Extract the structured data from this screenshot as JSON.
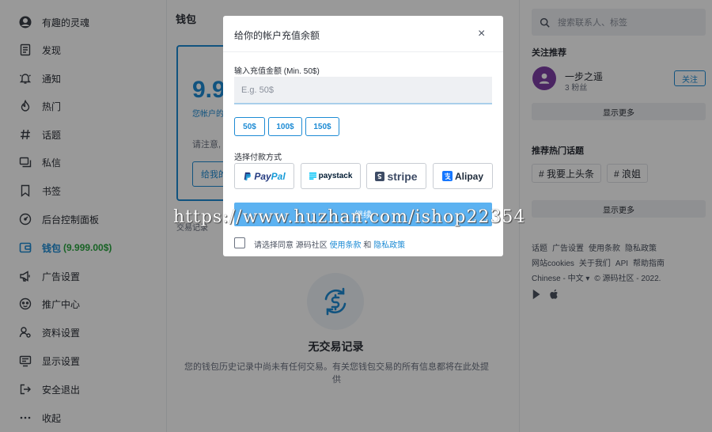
{
  "sidebar": {
    "items": [
      {
        "label": "有趣的灵魂",
        "icon": "avatar-icon"
      },
      {
        "label": "发现",
        "icon": "document-icon"
      },
      {
        "label": "通知",
        "icon": "bell-icon"
      },
      {
        "label": "热门",
        "icon": "fire-icon"
      },
      {
        "label": "话题",
        "icon": "hashtag-icon"
      },
      {
        "label": "私信",
        "icon": "message-icon"
      },
      {
        "label": "书签",
        "icon": "bookmark-icon"
      },
      {
        "label": "后台控制面板",
        "icon": "dashboard-icon"
      },
      {
        "label": "钱包",
        "amount": "(9.999.00$)",
        "icon": "wallet-icon"
      },
      {
        "label": "广告设置",
        "icon": "megaphone-icon"
      },
      {
        "label": "推广中心",
        "icon": "referral-icon"
      },
      {
        "label": "资料设置",
        "icon": "user-settings-icon"
      },
      {
        "label": "显示设置",
        "icon": "display-icon"
      },
      {
        "label": "安全退出",
        "icon": "logout-icon"
      },
      {
        "label": "收起",
        "icon": "more-icon"
      }
    ]
  },
  "main": {
    "title": "钱包",
    "wallet": {
      "balance": "9.9",
      "subtitle": "您帐户的",
      "note": "请注意,",
      "button": "给我的"
    },
    "transactions_label": "交易记录",
    "empty": {
      "title": "无交易记录",
      "description": "您的钱包历史记录中尚未有任何交易。有关您钱包交易的所有信息都将在此处提供"
    }
  },
  "right": {
    "search_placeholder": "搜索联系人、标签",
    "follow_title": "关注推荐",
    "follow_user": {
      "name": "一步之遥",
      "followers": "3 粉丝",
      "button": "关注"
    },
    "show_more": "显示更多",
    "topics_title": "推荐热门话题",
    "topics": [
      "# 我要上头条",
      "# 浪姐"
    ],
    "footer_line1": [
      "话题",
      "广告设置",
      "使用条款",
      "隐私政策"
    ],
    "footer_line2": [
      "网站cookies",
      "关于我们",
      "API",
      "帮助指南"
    ],
    "footer_line3": [
      "Chinese - 中文 ▾",
      "© 源码社区 - 2022."
    ]
  },
  "modal": {
    "title": "给你的帐户充值余额",
    "close": "×",
    "amount_label": "输入充值金额 (Min. 50$)",
    "amount_placeholder": "E.g. 50$",
    "presets": [
      "50$",
      "100$",
      "150$"
    ],
    "method_label": "选择付款方式",
    "methods": {
      "paypal_1": "Pay",
      "paypal_2": "Pal",
      "paystack": "paystack",
      "stripe": "stripe",
      "alipay": "Alipay"
    },
    "pay_button": "继续",
    "agree_prefix": "请选择同意 源码社区",
    "agree_terms": "使用条款",
    "agree_and": "和",
    "agree_privacy": "隐私政策"
  },
  "watermark": "https://www.huzhan.com/ishop22354",
  "colors": {
    "accent": "#1d8bd4",
    "balance_green": "#2ba640",
    "pay_button": "#5cb2f1",
    "avatar": "#7d3ea6"
  }
}
